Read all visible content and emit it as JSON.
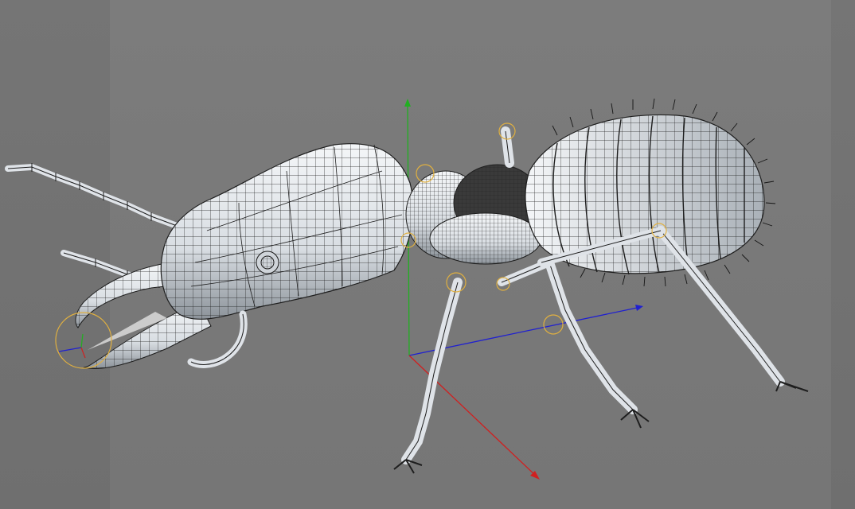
{
  "viewport": {
    "background_color": "#7a7a7a",
    "safe_frame_color": "#717171",
    "model_type": "termite-wireframe-mesh"
  },
  "colors": {
    "mesh_fill": "#dfe3e8",
    "mesh_shade": "#9fa6ad",
    "wire": "#1e1e1e",
    "handle": "#e0b040",
    "axis_x": "#d02020",
    "axis_y": "#20b020",
    "axis_z": "#2020d0"
  },
  "icons": {
    "world_axis": "axis-gizmo-icon",
    "joint": "joint-handle-icon"
  }
}
